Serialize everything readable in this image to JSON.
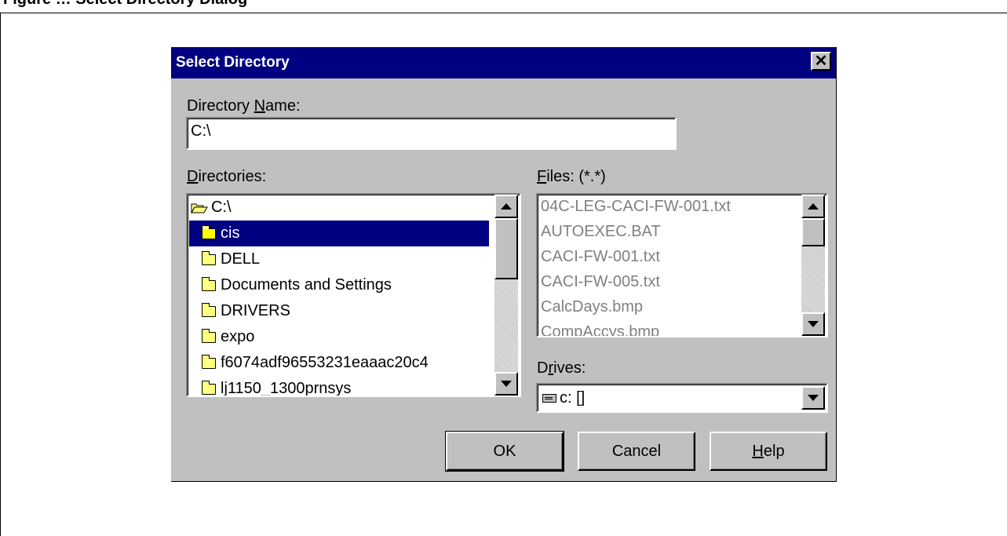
{
  "page": {
    "heading": "Figure … Select Directory Dialog"
  },
  "dialog": {
    "title": "Select Directory",
    "directory_name_label_pre": "Directory ",
    "directory_name_label_u": "N",
    "directory_name_label_post": "ame:",
    "directory_name_value": "C:\\",
    "directories_label_u": "D",
    "directories_label_post": "irectories:",
    "files_label_u": "F",
    "files_label_post": "iles: (*.*)",
    "drives_label_pre": "D",
    "drives_label_u": "r",
    "drives_label_post": "ives:",
    "root": "C:\\",
    "directories": [
      "cis",
      "DELL",
      "Documents and Settings",
      "DRIVERS",
      "expo",
      "f6074adf96553231eaaac20c4",
      "lj1150_1300prnsys"
    ],
    "selected_directory": "cis",
    "files": [
      "04C-LEG-CACI-FW-001.txt",
      "AUTOEXEC.BAT",
      "CACI-FW-001.txt",
      "CACI-FW-005.txt",
      "CalcDays.bmp",
      "CompAccys.bmp"
    ],
    "drive_value": "c: []",
    "buttons": {
      "ok": "OK",
      "cancel": "Cancel",
      "help_u": "H",
      "help_post": "elp"
    }
  },
  "colors": {
    "titlebar": "#000080",
    "dialog_face": "#c0c0c0",
    "selection": "#000080"
  },
  "icons": {
    "close": "close-icon",
    "folder": "folder-icon",
    "open_folder": "open-folder-icon",
    "drive": "drive-icon"
  }
}
